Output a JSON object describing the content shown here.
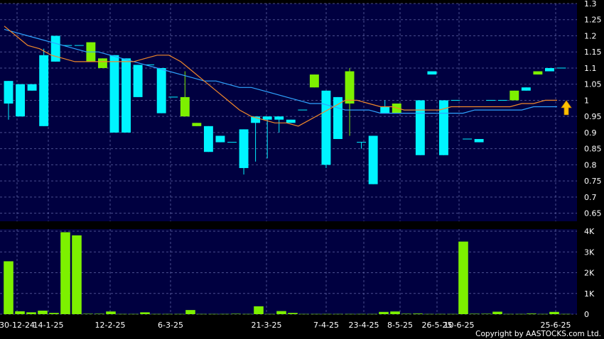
{
  "chart_data": {
    "type": "candlestick",
    "price_panel": {
      "ylim": [
        0.625,
        1.3
      ],
      "y_ticks": [
        "1.3",
        "1.25",
        "1.2",
        "1.15",
        "1.1",
        "1.05",
        "1",
        "0.95",
        "0.9",
        "0.85",
        "0.8",
        "0.75",
        "0.7",
        "0.65"
      ],
      "candles": [
        {
          "o": 0.99,
          "c": 1.06,
          "h": 1.06,
          "l": 0.94,
          "up": false
        },
        {
          "o": 1.05,
          "c": 0.95,
          "h": 1.05,
          "l": 0.95,
          "up": false
        },
        {
          "o": 1.05,
          "c": 1.03,
          "h": 1.05,
          "l": 1.03,
          "up": false
        },
        {
          "o": 0.92,
          "c": 1.14,
          "h": 1.16,
          "l": 0.92,
          "up": false
        },
        {
          "o": 1.12,
          "c": 1.2,
          "h": 1.2,
          "l": 1.12,
          "up": false
        },
        {
          "o": 1.17,
          "c": 1.17,
          "h": 1.17,
          "l": 1.17,
          "up": false
        },
        {
          "o": 1.17,
          "c": 1.17,
          "h": 1.17,
          "l": 1.17,
          "up": false
        },
        {
          "o": 1.12,
          "c": 1.18,
          "h": 1.18,
          "l": 1.12,
          "up": true
        },
        {
          "o": 1.1,
          "c": 1.13,
          "h": 1.13,
          "l": 1.1,
          "up": true
        },
        {
          "o": 0.9,
          "c": 1.14,
          "h": 1.14,
          "l": 0.9,
          "up": false
        },
        {
          "o": 0.9,
          "c": 1.13,
          "h": 1.13,
          "l": 0.9,
          "up": false
        },
        {
          "o": 1.01,
          "c": 1.11,
          "h": 1.11,
          "l": 1.01,
          "up": false
        },
        {
          "o": 1.11,
          "c": 1.11,
          "h": 1.11,
          "l": 1.11,
          "up": false
        },
        {
          "o": 0.96,
          "c": 1.1,
          "h": 1.1,
          "l": 0.96,
          "up": false
        },
        {
          "o": 1.01,
          "c": 1.01,
          "h": 1.01,
          "l": 1.01,
          "up": false
        },
        {
          "o": 1.01,
          "c": 0.95,
          "h": 1.09,
          "l": 0.95,
          "up": true
        },
        {
          "o": 0.93,
          "c": 0.92,
          "h": 0.93,
          "l": 0.92,
          "up": true
        },
        {
          "o": 0.84,
          "c": 0.92,
          "h": 0.92,
          "l": 0.84,
          "up": false
        },
        {
          "o": 0.87,
          "c": 0.89,
          "h": 0.89,
          "l": 0.87,
          "up": false
        },
        {
          "o": 0.87,
          "c": 0.87,
          "h": 0.87,
          "l": 0.87,
          "up": false
        },
        {
          "o": 0.79,
          "c": 0.91,
          "h": 0.91,
          "l": 0.77,
          "up": false
        },
        {
          "o": 0.93,
          "c": 0.95,
          "h": 0.95,
          "l": 0.81,
          "up": false
        },
        {
          "o": 0.94,
          "c": 0.95,
          "h": 0.95,
          "l": 0.82,
          "up": false
        },
        {
          "o": 0.94,
          "c": 0.95,
          "h": 0.95,
          "l": 0.9,
          "up": false
        },
        {
          "o": 0.93,
          "c": 0.94,
          "h": 0.94,
          "l": 0.93,
          "up": false
        },
        {
          "o": 0.97,
          "c": 0.97,
          "h": 0.97,
          "l": 0.97,
          "up": false
        },
        {
          "o": 1.04,
          "c": 1.08,
          "h": 1.08,
          "l": 1.04,
          "up": true
        },
        {
          "o": 0.8,
          "c": 1.03,
          "h": 1.03,
          "l": 0.79,
          "up": false
        },
        {
          "o": 0.88,
          "c": 1.01,
          "h": 1.01,
          "l": 0.88,
          "up": false
        },
        {
          "o": 0.99,
          "c": 1.09,
          "h": 1.1,
          "l": 0.89,
          "up": true
        },
        {
          "o": 0.87,
          "c": 0.87,
          "h": 0.87,
          "l": 0.85,
          "up": false
        },
        {
          "o": 0.74,
          "c": 0.89,
          "h": 0.89,
          "l": 0.74,
          "up": false
        },
        {
          "o": 0.96,
          "c": 0.98,
          "h": 1.0,
          "l": 0.96,
          "up": false
        },
        {
          "o": 0.96,
          "c": 0.99,
          "h": 0.99,
          "l": 0.96,
          "up": true
        },
        {
          "o": 0.97,
          "c": 0.97,
          "h": 0.97,
          "l": 0.97,
          "up": false
        },
        {
          "o": 0.83,
          "c": 1.0,
          "h": 1.0,
          "l": 0.83,
          "up": false
        },
        {
          "o": 1.08,
          "c": 1.09,
          "h": 1.09,
          "l": 1.08,
          "up": false
        },
        {
          "o": 0.83,
          "c": 1.0,
          "h": 1.0,
          "l": 0.83,
          "up": false
        },
        {
          "o": 1.0,
          "c": 1.0,
          "h": 1.0,
          "l": 1.0,
          "up": false
        },
        {
          "o": 0.88,
          "c": 0.88,
          "h": 0.88,
          "l": 0.88,
          "up": false
        },
        {
          "o": 0.87,
          "c": 0.88,
          "h": 0.88,
          "l": 0.87,
          "up": false
        },
        {
          "o": 1.0,
          "c": 1.0,
          "h": 1.0,
          "l": 1.0,
          "up": false
        },
        {
          "o": 1.0,
          "c": 1.0,
          "h": 1.0,
          "l": 1.0,
          "up": false
        },
        {
          "o": 1.0,
          "c": 1.03,
          "h": 1.03,
          "l": 1.0,
          "up": true
        },
        {
          "o": 1.03,
          "c": 1.04,
          "h": 1.04,
          "l": 1.03,
          "up": false
        },
        {
          "o": 1.08,
          "c": 1.09,
          "h": 1.09,
          "l": 1.08,
          "up": true
        },
        {
          "o": 1.09,
          "c": 1.1,
          "h": 1.1,
          "l": 1.09,
          "up": false
        },
        {
          "o": 1.1,
          "c": 1.1,
          "h": 1.1,
          "l": 1.1,
          "up": false
        }
      ],
      "ma_short": [
        1.23,
        1.2,
        1.17,
        1.16,
        1.14,
        1.13,
        1.12,
        1.12,
        1.12,
        1.12,
        1.12,
        1.12,
        1.13,
        1.14,
        1.14,
        1.12,
        1.09,
        1.06,
        1.03,
        1.0,
        0.97,
        0.95,
        0.94,
        0.93,
        0.93,
        0.92,
        0.94,
        0.96,
        0.98,
        1.0,
        1.0,
        0.99,
        0.98,
        0.98,
        0.97,
        0.97,
        0.97,
        0.97,
        0.98,
        0.98,
        0.98,
        0.98,
        0.98,
        0.98,
        0.99,
        0.99,
        1.0,
        1.0
      ],
      "ma_long": [
        1.22,
        1.21,
        1.2,
        1.19,
        1.18,
        1.17,
        1.16,
        1.15,
        1.15,
        1.14,
        1.13,
        1.12,
        1.11,
        1.1,
        1.09,
        1.08,
        1.07,
        1.06,
        1.06,
        1.05,
        1.04,
        1.04,
        1.03,
        1.02,
        1.01,
        1.0,
        0.99,
        0.99,
        0.98,
        0.97,
        0.97,
        0.97,
        0.96,
        0.96,
        0.96,
        0.96,
        0.96,
        0.96,
        0.96,
        0.96,
        0.97,
        0.97,
        0.97,
        0.97,
        0.97,
        0.98,
        0.98,
        0.98
      ]
    },
    "volume_panel": {
      "ylim": [
        0,
        4000
      ],
      "y_ticks": [
        "4K",
        "3K",
        "2K",
        "1K",
        "0"
      ],
      "volumes": [
        2550,
        140,
        90,
        170,
        60,
        3950,
        3800,
        20,
        20,
        130,
        10,
        10,
        90,
        10,
        10,
        10,
        200,
        10,
        10,
        10,
        20,
        10,
        380,
        10,
        150,
        60,
        10,
        10,
        10,
        10,
        10,
        10,
        10,
        110,
        130,
        20,
        30,
        10,
        10,
        10,
        3500,
        20,
        20,
        120,
        10,
        10,
        30,
        10,
        110,
        10
      ]
    },
    "x_tick_labels": [
      "30-12-24",
      "14-1-25",
      "12-2-25",
      "6-3-25",
      "21-3-25",
      "7-4-25",
      "23-4-25",
      "8-5-25",
      "26-5-25",
      "10-6-25",
      "25-6-25"
    ],
    "colors": {
      "plot_bg": "#000040",
      "down_candle": "#00f4ff",
      "up_candle": "#7df000",
      "volume_bar": "#7df000",
      "ma_short": "#f0882a",
      "ma_long": "#2fa4ff",
      "arrow": "#ffc000"
    },
    "copyright": "Copyright by AASTOCKS.com Ltd."
  }
}
